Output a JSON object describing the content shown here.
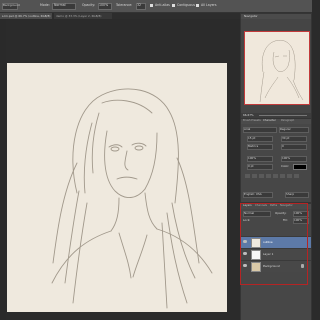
{
  "options_bar": {
    "tool_preset": "Background",
    "mode_label": "Mode:",
    "mode_value": "Normal",
    "opacity_label": "Opacity:",
    "opacity_value": "100%",
    "tolerance_label": "Tolerance:",
    "tolerance_value": "32",
    "anti_alias": "Anti-alias",
    "contiguous": "Contiguous",
    "all_layers": "All Layers"
  },
  "doc_tabs": [
    {
      "label": "s.Im.psd @ 66.7% (outline, RGB/8)"
    },
    {
      "label": "demo @ 33.3% (Layer 2, RGB/8)"
    }
  ],
  "navigator": {
    "title": "Navigator",
    "zoom": "66.67%"
  },
  "character": {
    "tabs": [
      "Brush Presets",
      "Character",
      "Paragraph"
    ],
    "font": "Arial",
    "style": "Regular",
    "size": "15 pt",
    "leading": "30 pt",
    "kerning": "Metrics",
    "tracking": "0",
    "vscale": "100%",
    "hscale": "100%",
    "baseline": "0 pt",
    "color_label": "Color:",
    "language": "English: USA",
    "aa": "Sharp"
  },
  "layers": {
    "tabs": [
      "Layers",
      "Channels",
      "Paths",
      "Navigator"
    ],
    "blend": "Normal",
    "opacity_label": "Opacity:",
    "opacity": "100%",
    "lock_label": "Lock:",
    "fill_label": "Fill:",
    "fill": "100%",
    "rows": [
      {
        "name": "outline"
      },
      {
        "name": "Layer 1"
      },
      {
        "name": "Background"
      }
    ]
  },
  "colors": {
    "accent_red": "#b52424",
    "selected_layer": "#5d7aa8"
  }
}
